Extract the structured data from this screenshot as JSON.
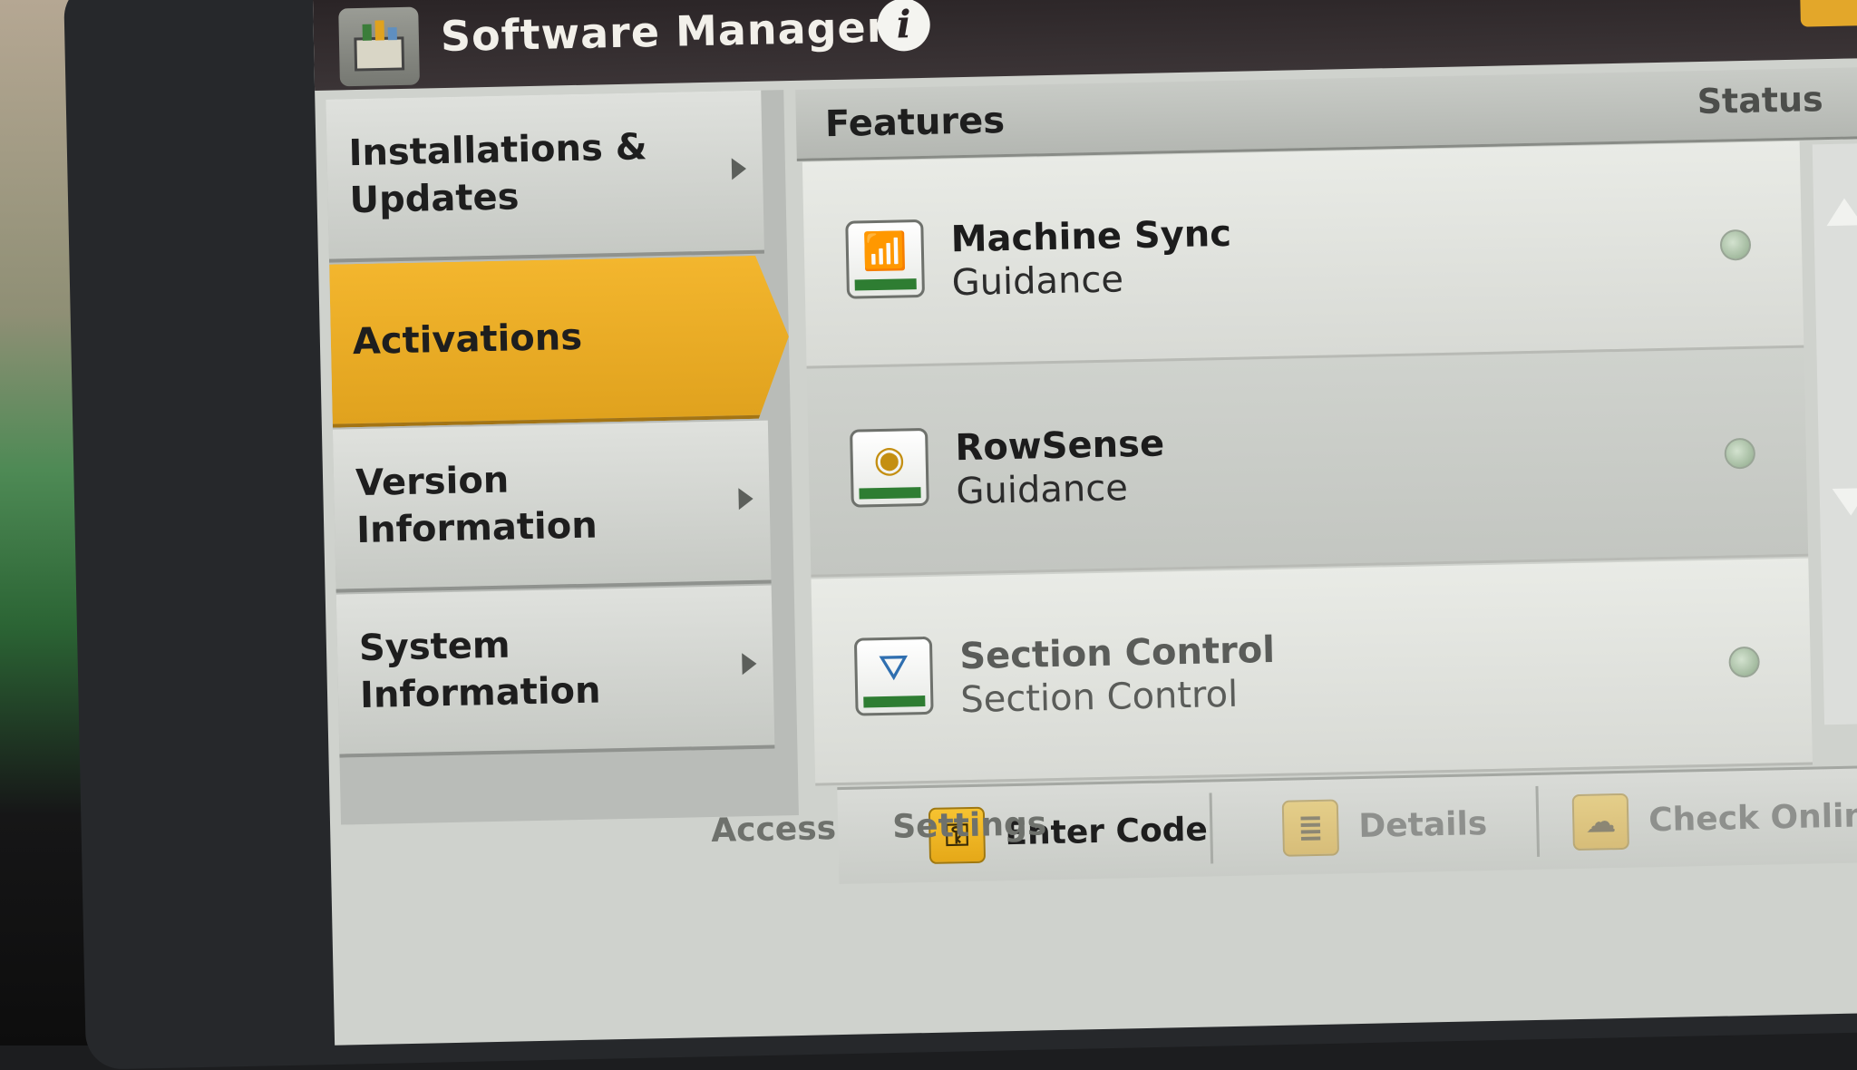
{
  "window": {
    "title": "Software Manager",
    "info_icon": "info-icon",
    "close_icon": "close-icon",
    "close_glyph": "✕"
  },
  "sidebar": {
    "items": [
      {
        "label": "Installations &\nUpdates",
        "active": false,
        "has_arrow": true
      },
      {
        "label": "Activations",
        "active": true,
        "has_arrow": false
      },
      {
        "label": "Version\nInformation",
        "active": false,
        "has_arrow": true
      },
      {
        "label": "System\nInformation",
        "active": false,
        "has_arrow": true
      }
    ]
  },
  "features_table": {
    "header_features": "Features",
    "header_status": "Status",
    "rows": [
      {
        "name": "Machine Sync",
        "category": "Guidance",
        "icon": "machine-sync-icon",
        "icon_glyph": "📶"
      },
      {
        "name": "RowSense",
        "category": "Guidance",
        "icon": "rowsense-icon",
        "icon_glyph": "◉"
      },
      {
        "name": "Section Control",
        "category": "Section Control",
        "icon": "section-control-icon",
        "icon_glyph": "⛛"
      }
    ]
  },
  "actions": {
    "enter_code": {
      "label": "Enter Code",
      "icon_glyph": "⚿"
    },
    "details": {
      "label": "Details",
      "icon_glyph": "≣"
    },
    "check_online": {
      "label": "Check Online",
      "icon_glyph": "☁"
    }
  },
  "below_screen": {
    "left": "Access",
    "right": "Settings"
  },
  "colors": {
    "accent": "#e0a21e",
    "titlebar": "#2a2426",
    "status_dot": "#a9c1a5"
  }
}
